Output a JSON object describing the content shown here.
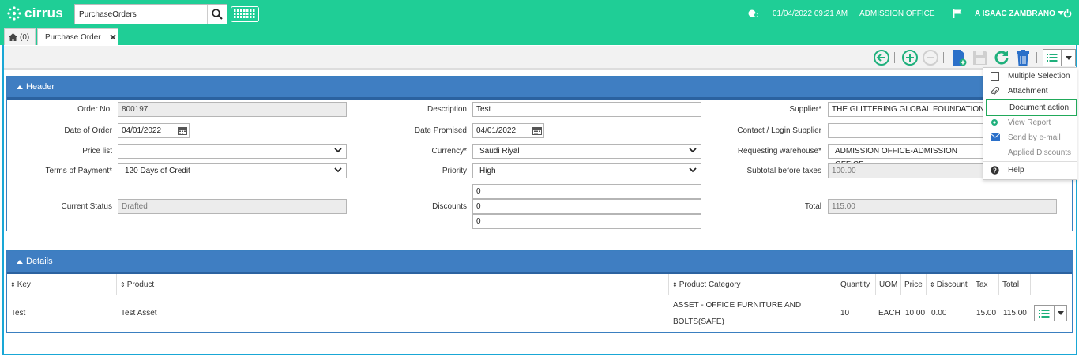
{
  "app": {
    "brand": "cirrus",
    "search_value": "PurchaseOrders",
    "datetime": "01/04/2022 09:21 AM",
    "office": "ADMISSION OFFICE",
    "user": "A ISAAC ZAMBRANO"
  },
  "tabs": [
    {
      "label": "(0)"
    },
    {
      "label": "Purchase Order"
    }
  ],
  "header": {
    "title": "Header",
    "fields": {
      "order_no": {
        "label": "Order No.",
        "value": "800197"
      },
      "date_of_order": {
        "label": "Date of Order",
        "value": "04/01/2022"
      },
      "price_list": {
        "label": "Price list",
        "value": ""
      },
      "terms_of_payment": {
        "label": "Terms of Payment*",
        "value": "120 Days of Credit"
      },
      "current_status": {
        "label": "Current Status",
        "value": "Drafted"
      },
      "description": {
        "label": "Description",
        "value": "Test"
      },
      "date_promised": {
        "label": "Date Promised",
        "value": "04/01/2022"
      },
      "currency": {
        "label": "Currency*",
        "value": "Saudi Riyal"
      },
      "priority": {
        "label": "Priority",
        "value": "High"
      },
      "discounts": {
        "label": "Discounts",
        "values": [
          "0",
          "0",
          "0"
        ]
      },
      "supplier": {
        "label": "Supplier*",
        "value": "THE GLITTERING GLOBAL FOUNDATION FOR"
      },
      "contact_login_supplier": {
        "label": "Contact / Login Supplier",
        "value": ""
      },
      "requesting_warehouse": {
        "label": "Requesting warehouse*",
        "value": "ADMISSION OFFICE-ADMISSION OFFICE"
      },
      "subtotal_before_taxes": {
        "label": "Subtotal before taxes",
        "value": "100.00"
      },
      "total": {
        "label": "Total",
        "value": "115.00"
      }
    }
  },
  "menu": {
    "items": [
      "Multiple Selection",
      "Attachment",
      "Document action",
      "View Report",
      "Send by e-mail",
      "Applied Discounts",
      "Help"
    ]
  },
  "details": {
    "title": "Details",
    "columns": [
      "Key",
      "Product",
      "Product Category",
      "Quantity",
      "UOM",
      "Price",
      "Discount",
      "Tax",
      "Total"
    ],
    "rows": [
      {
        "key": "Test",
        "product": "Test Asset",
        "category_line1": "ASSET - OFFICE FURNITURE AND",
        "category_line2": "BOLTS(SAFE)",
        "quantity": "10",
        "uom": "EACH",
        "price": "10.00",
        "discount": "0.00",
        "tax": "15.00",
        "total": "115.00"
      }
    ]
  },
  "colors": {
    "topbar": "#1fce96",
    "panel_header": "#3f7ec2",
    "highlight": "#21a95a",
    "toolbar_icon": "#1fb07c",
    "doc_icon": "#2b70c9",
    "frame": "#19a7d6"
  }
}
